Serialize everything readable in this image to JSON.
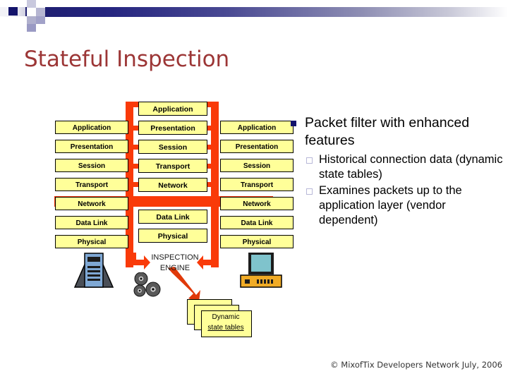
{
  "slide": {
    "title": "Stateful Inspection",
    "footer": "© MixofTix Developers Network July, 2006"
  },
  "colors": {
    "title": "#9c3636",
    "accent_red": "#f93a09",
    "box_yellow": "#ffff99",
    "bullet_navy": "#13136b",
    "subbullet_outline": "#b8b8d8",
    "header_gradient_start": "#1d1d6e",
    "header_gradient_end": "#ffffff"
  },
  "diagram": {
    "left_stack": {
      "name": "host-osi-stack-left",
      "layers": [
        "Application",
        "Presentation",
        "Session",
        "Transport",
        "Network",
        "Data Link",
        "Physical"
      ]
    },
    "middle_stack": {
      "name": "firewall-osi-stack",
      "layers": [
        "Application",
        "Presentation",
        "Session",
        "Transport",
        "Network",
        "Data Link",
        "Physical"
      ]
    },
    "right_stack": {
      "name": "host-osi-stack-right",
      "layers": [
        "Application",
        "Presentation",
        "Session",
        "Transport",
        "Network",
        "Data Link",
        "Physical"
      ]
    },
    "inspection_engine": {
      "line1": "INSPECTION",
      "line2": "ENGINE"
    },
    "state_tables": {
      "line1": "Dynamic",
      "line2": "state tables"
    },
    "devices": {
      "left": "server-tower-icon",
      "right": "desktop-computer-icon",
      "engine": "gears-icon"
    }
  },
  "bullets": {
    "main": "Packet filter with enhanced features",
    "sub": [
      "Historical connection data (dynamic state tables)",
      "Examines packets up to the application layer (vendor dependent)"
    ]
  }
}
